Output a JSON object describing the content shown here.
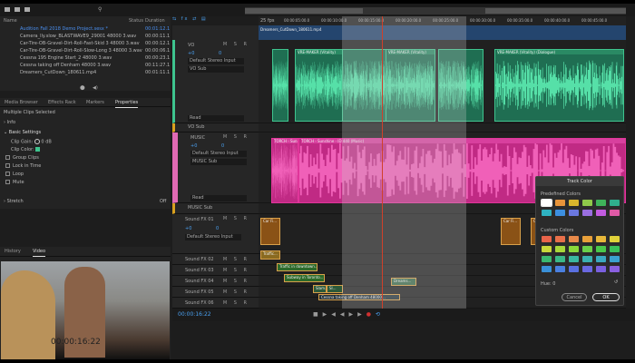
{
  "files": {
    "header": {
      "name": "Name",
      "status": "Status",
      "duration": "Duration"
    },
    "items": [
      {
        "name": "Audition Fall 2018 Demo Project.sesx *",
        "duration": "00:01:12.1",
        "selected": true
      },
      {
        "name": "Camera_lly.slow_BLASTWAVE9_29001 48000 3.wav",
        "duration": "00:00:11.1"
      },
      {
        "name": "Car-Tire-OB-Gravel-Dirt-Roll-Fast-Skid 3 48000 3.wav",
        "duration": "00:00:12.1"
      },
      {
        "name": "Car-Tire-OB-Gravel-Dirt-Roll-Slow-Long 3 48000 3.wav",
        "duration": "00:00:06.1"
      },
      {
        "name": "Cessna 195 Engine Start_2 48000 3.wav",
        "duration": "00:00:23.1"
      },
      {
        "name": "Cessna taking off Denham 48000 3.wav",
        "duration": "00:11:27.1"
      },
      {
        "name": "Dreamers_CutDown_180611.mp4",
        "duration": "00:01:11.1"
      }
    ]
  },
  "tabs": [
    "Media Browser",
    "Effects Rack",
    "Markers",
    "Properties"
  ],
  "properties": {
    "title": "Multiple Clips Selected",
    "info": "Info",
    "basic": "Basic Settings",
    "clip_gain_label": "Clip Gain:",
    "clip_gain_value": "0",
    "clip_gain_unit": "dB",
    "clip_color_label": "Clip Color:",
    "checks": [
      "Group Clips",
      "Lock in Time",
      "Loop",
      "Mute"
    ],
    "stretch": "Stretch",
    "stretch_value": "Off"
  },
  "bottom_tabs": [
    "History",
    "Video"
  ],
  "video": {
    "timecode": "00:00:16:22"
  },
  "timeline": {
    "fps": "25 fps",
    "ruler": [
      "00:00:05:00.0",
      "00:00:10:00.0",
      "00:00:15:00.0",
      "00:00:20:00.0",
      "00:00:25:00.0",
      "00:00:30:00.0",
      "00:00:35:00.0",
      "00:00:40:00.0",
      "00:00:45:00.0"
    ],
    "video_clip": "Dreamers_CutDown_180611.mp4",
    "current_time": "00:00:16:22"
  },
  "tracks": {
    "vo": {
      "name": "VO",
      "input": "Default Stereo Input",
      "output": "VO Sub",
      "mode": "Read",
      "volume": "+0",
      "pan": "0"
    },
    "vo_sub": {
      "name": "VO Sub"
    },
    "music": {
      "name": "MUSIC",
      "input": "Default Stereo Input",
      "output": "MUSIC Sub",
      "mode": "Read",
      "volume": "+0",
      "pan": "0"
    },
    "music_sub": {
      "name": "MUSIC Sub"
    },
    "fx01": {
      "name": "Sound FX 01",
      "input": "Default Stereo Input",
      "volume": "+0",
      "pan": "0"
    },
    "others": [
      "Sound FX 02",
      "Sound FX 03",
      "Sound FX 04",
      "Sound FX 05",
      "Sound FX 06"
    ],
    "btns": "M S R"
  },
  "clips": {
    "vo": [
      "VRE-MAKER (Vitality)",
      "VRE-MAKER (Vitality)",
      "VRE-MAKER (Vitality) (Dialogue)"
    ],
    "music": [
      "TORCH - Sunshine",
      "TORCH - Sunshine - ID 440 (Music)"
    ],
    "fx": [
      "Car Fi...",
      "Traffic...",
      "Traffic in downtown...",
      "Subway in Toronto...",
      "Slam...",
      "Sl...",
      "Dreams...",
      "Cessna taking off Denham 48000..."
    ]
  },
  "dialog": {
    "title": "Track Color",
    "predefined_label": "Predefined Colors",
    "custom_label": "Custom Colors",
    "hue_label": "Hue: 0",
    "cancel": "Cancel",
    "ok": "OK",
    "predefined": [
      "#ffffff",
      "#e8943a",
      "#d9b62c",
      "#8fc94a",
      "#3fb35a",
      "#2fae8d",
      "#2fb3c2",
      "#3c8fe0",
      "#6b78e0",
      "#9a6ee0",
      "#c25be0",
      "#e05aa6"
    ],
    "custom": [
      "#e8644a",
      "#e8704a",
      "#e88a4a",
      "#e8a03a",
      "#e8b83a",
      "#e0d23a",
      "#c8d83a",
      "#a8d83a",
      "#8ad83a",
      "#6ad04a",
      "#4ac84a",
      "#3ac05a",
      "#3ab870",
      "#3ab888",
      "#3ab8a0",
      "#3ab0b0",
      "#3aa8c0",
      "#3aa0d0",
      "#3a90d8",
      "#4a80e0",
      "#5a70e0",
      "#6a68e0",
      "#7a60e0",
      "#8a60e0"
    ]
  },
  "colors": {
    "vo": "#3ec48e",
    "music": "#e0359a",
    "fx": "#b5701e",
    "accent": "#2d8ceb"
  }
}
